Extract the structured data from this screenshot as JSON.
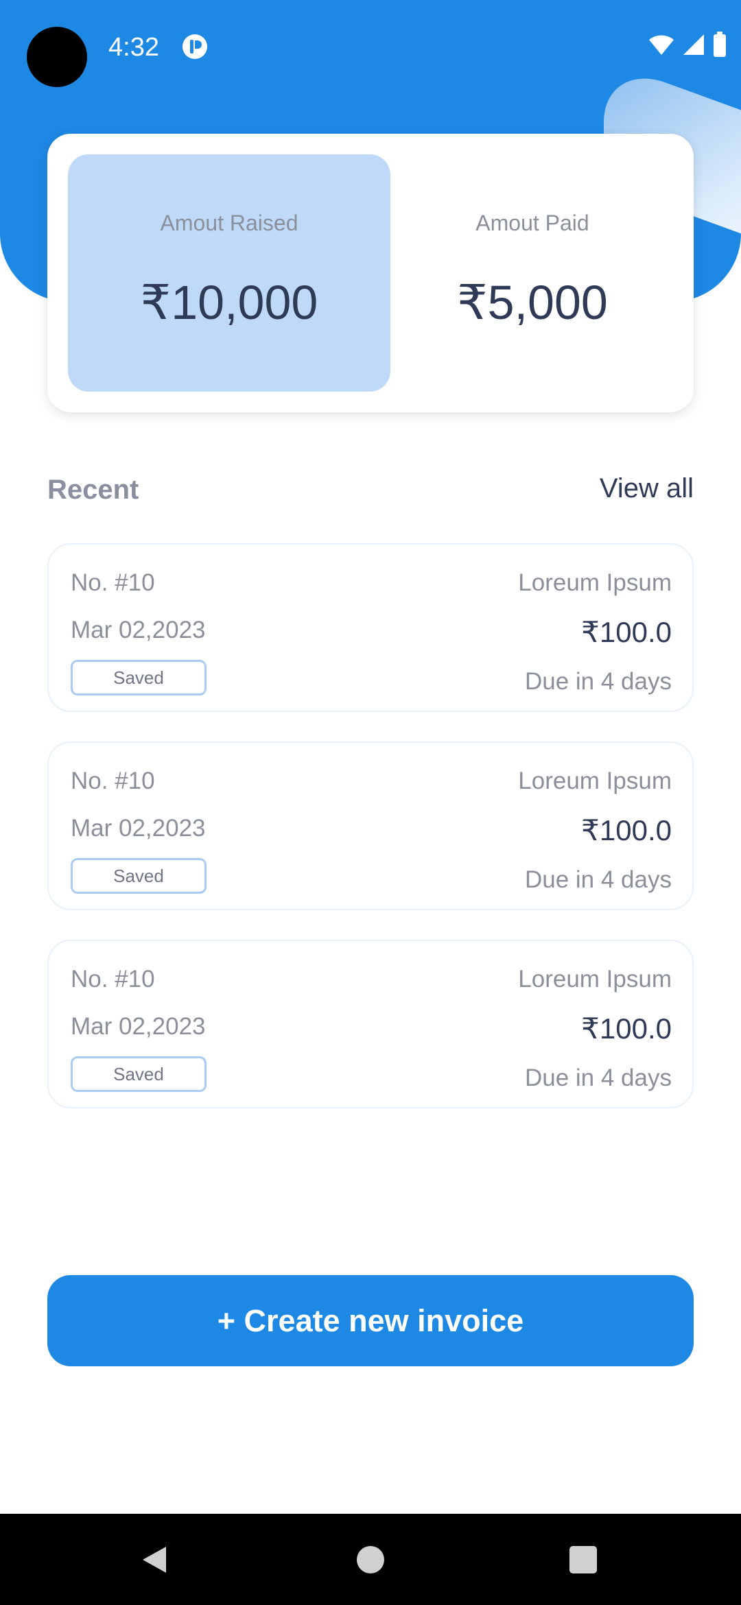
{
  "status_bar": {
    "time": "4:32",
    "icons": [
      "app-notification-icon",
      "wifi-icon",
      "signal-icon",
      "battery-icon"
    ]
  },
  "colors": {
    "primary": "#1e88e5",
    "highlight": "#bfdaf9",
    "text_dark": "#2f3a56",
    "text_muted": "#8a8f9a"
  },
  "summary": {
    "raised": {
      "label": "Amout Raised",
      "value": "₹10,000"
    },
    "paid": {
      "label": "Amout Paid",
      "value": "₹5,000"
    }
  },
  "recent": {
    "title": "Recent",
    "view_all": "View all",
    "items": [
      {
        "number": "No. #10",
        "date": "Mar 02,2023",
        "status": "Saved",
        "name": "Loreum Ipsum",
        "amount": "₹100.0",
        "due": "Due in 4 days"
      },
      {
        "number": "No. #10",
        "date": "Mar 02,2023",
        "status": "Saved",
        "name": "Loreum Ipsum",
        "amount": "₹100.0",
        "due": "Due in 4 days"
      },
      {
        "number": "No. #10",
        "date": "Mar 02,2023",
        "status": "Saved",
        "name": "Loreum Ipsum",
        "amount": "₹100.0",
        "due": "Due in 4 days"
      }
    ]
  },
  "actions": {
    "create_invoice": "+ Create new invoice"
  },
  "nav": {
    "icons": [
      "back-icon",
      "home-icon",
      "recents-icon"
    ]
  }
}
